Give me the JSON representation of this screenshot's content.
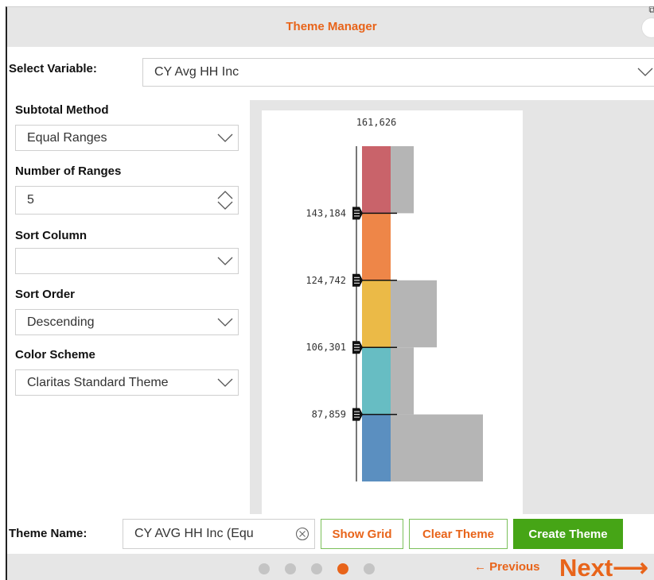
{
  "dialog": {
    "title": "Theme Manager",
    "close_icon": "close-icon",
    "popout_icon": "popout-icon"
  },
  "variable": {
    "label": "Select Variable:",
    "value": "CY Avg HH Inc"
  },
  "subtotal_method": {
    "label": "Subtotal Method",
    "value": "Equal Ranges"
  },
  "number_of_ranges": {
    "label": "Number of Ranges",
    "value": "5"
  },
  "sort_column": {
    "label": "Sort Column",
    "value": ""
  },
  "sort_order": {
    "label": "Sort Order",
    "value": "Descending"
  },
  "color_scheme": {
    "label": "Color Scheme",
    "value": "Claritas Standard Theme"
  },
  "chart_data": {
    "type": "bar",
    "top_label": "161,626",
    "breaks": [
      "143,184",
      "124,742",
      "106,301",
      "87,859"
    ],
    "ranges": [
      {
        "color": "#c9636a",
        "distribution": 0.25
      },
      {
        "color": "#ee8648",
        "distribution": 0.0
      },
      {
        "color": "#ebba47",
        "distribution": 0.5
      },
      {
        "color": "#67bdc3",
        "distribution": 0.25
      },
      {
        "color": "#5b8fc0",
        "distribution": 1.0
      }
    ],
    "distribution_color": "#b5b5b5"
  },
  "theme_name": {
    "label": "Theme Name:",
    "value": "CY AVG HH Inc (Equ"
  },
  "buttons": {
    "show_grid": "Show Grid",
    "clear_theme": "Clear Theme",
    "create_theme": "Create Theme"
  },
  "navigation": {
    "steps": 5,
    "active_step": 4,
    "previous": "← Previous",
    "next": "Next⟶"
  },
  "colors": {
    "accent": "#e8641a",
    "primary_button": "#46a516"
  }
}
